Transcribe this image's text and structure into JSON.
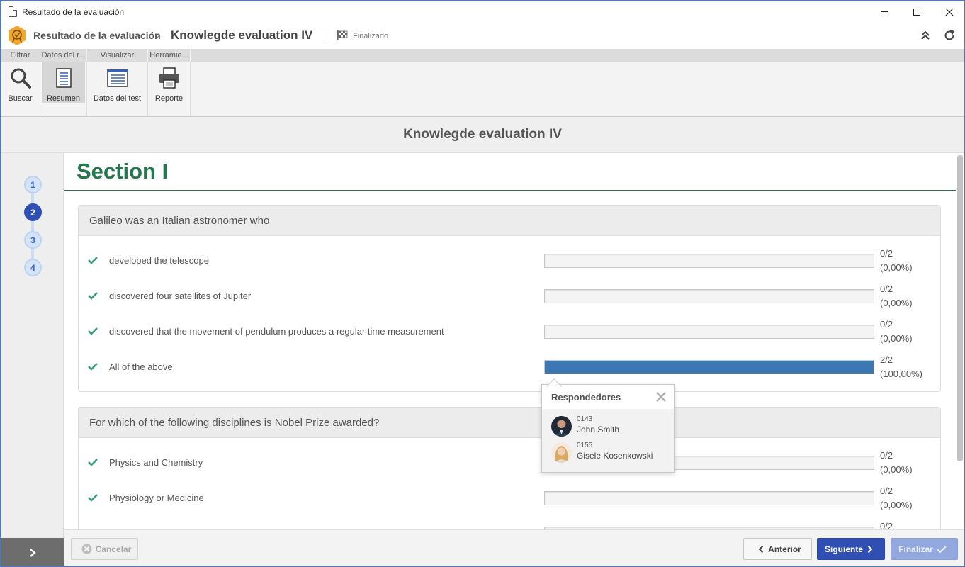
{
  "window": {
    "title": "Resultado de la evaluación"
  },
  "header": {
    "breadcrumb_root": "Resultado de la evaluación",
    "breadcrumb_separator": "›",
    "breadcrumb_current": "Knowlegde evaluation IV",
    "status": "Finalizado",
    "badge_color": "#f0a830"
  },
  "ribbon": {
    "tabs": [
      "Filtrar",
      "Datos del r...",
      "Visualizar",
      "Herramie..."
    ],
    "buttons": {
      "search": "Buscar",
      "summary": "Resumen",
      "test_data": "Datos del test",
      "report": "Reporte"
    }
  },
  "page_title": "Knowlegde evaluation IV",
  "stepper": {
    "steps": [
      "1",
      "2",
      "3",
      "4"
    ],
    "current": "2"
  },
  "section": {
    "title": "Section I",
    "color": "#23774d"
  },
  "questions": [
    {
      "text": "Galileo was an Italian astronomer who",
      "options": [
        {
          "label": "developed the telescope",
          "count": "0/2",
          "percent": "(0,00%)",
          "fraction": 0
        },
        {
          "label": "discovered four satellites of Jupiter",
          "count": "0/2",
          "percent": "(0,00%)",
          "fraction": 0
        },
        {
          "label": "discovered that the movement of pendulum produces a regular time measurement",
          "count": "0/2",
          "percent": "(0,00%)",
          "fraction": 0
        },
        {
          "label": "All of the above",
          "count": "2/2",
          "percent": "(100,00%)",
          "fraction": 1
        }
      ]
    },
    {
      "text": "For which of the following disciplines is Nobel Prize awarded?",
      "options": [
        {
          "label": "Physics and Chemistry",
          "count": "0/2",
          "percent": "(0,00%)",
          "fraction": 0
        },
        {
          "label": "Physiology or Medicine",
          "count": "0/2",
          "percent": "(0,00%)",
          "fraction": 0
        },
        {
          "label": "",
          "count": "0/2",
          "percent": "",
          "fraction": 0
        }
      ]
    }
  ],
  "popover": {
    "title": "Respondedores",
    "respondents": [
      {
        "id": "0143",
        "name": "John Smith"
      },
      {
        "id": "0155",
        "name": "Gisele Kosenkowski"
      }
    ]
  },
  "footer": {
    "cancel": "Cancelar",
    "previous": "Anterior",
    "next": "Siguiente",
    "finish": "Finalizar"
  },
  "colors": {
    "accent": "#2f4fb5",
    "bar_fill": "#3b78b4",
    "check": "#3aa07a"
  }
}
